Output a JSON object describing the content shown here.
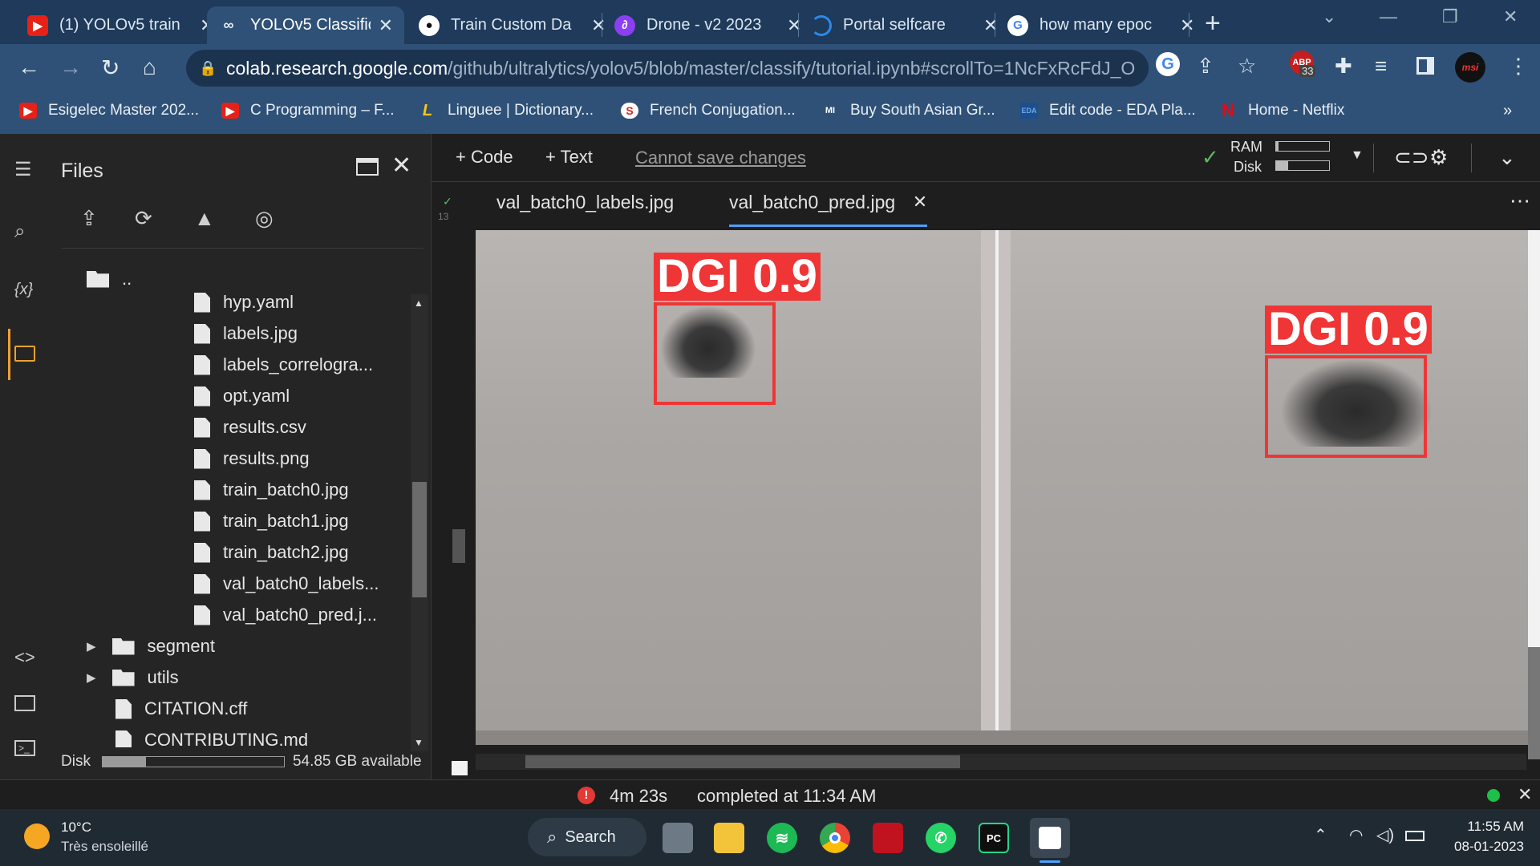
{
  "browser": {
    "tabs": [
      {
        "title": "(1) YOLOv5 train",
        "icon": "youtube-icon"
      },
      {
        "title": "YOLOv5 Classific",
        "icon": "colab-icon",
        "active": true
      },
      {
        "title": "Train Custom Da",
        "icon": "github-icon"
      },
      {
        "title": "Drone - v2 2023",
        "icon": "roboflow-icon"
      },
      {
        "title": "Portal selfcare",
        "icon": "portal-icon"
      },
      {
        "title": "how many epoc",
        "icon": "google-icon"
      }
    ],
    "url_domain": "colab.research.google.com",
    "url_path": "/github/ultralytics/yolov5/blob/master/classify/tutorial.ipynb#scrollTo=1NcFxRcFdJ_O",
    "extension_badge": "33",
    "bookmarks": [
      "Esigelec Master 202...",
      "C Programming – F...",
      "Linguee | Dictionary...",
      "French Conjugation...",
      "Buy South Asian Gr...",
      "Edit code - EDA Pla...",
      "Home - Netflix"
    ],
    "more_bookmarks": "»"
  },
  "colab": {
    "toolbar": {
      "code_label": "+ Code",
      "text_label": "+ Text",
      "cannot_save": "Cannot save changes",
      "ram_label": "RAM",
      "disk_label": "Disk",
      "ram_usage": 0.05,
      "disk_usage": 0.22
    },
    "files": {
      "title": "Files",
      "parent": "..",
      "items": [
        {
          "name": "hyp.yaml",
          "type": "file"
        },
        {
          "name": "labels.jpg",
          "type": "file"
        },
        {
          "name": "labels_correlogra...",
          "type": "file"
        },
        {
          "name": "opt.yaml",
          "type": "file"
        },
        {
          "name": "results.csv",
          "type": "file"
        },
        {
          "name": "results.png",
          "type": "file"
        },
        {
          "name": "train_batch0.jpg",
          "type": "file"
        },
        {
          "name": "train_batch1.jpg",
          "type": "file"
        },
        {
          "name": "train_batch2.jpg",
          "type": "file"
        },
        {
          "name": "val_batch0_labels...",
          "type": "file"
        },
        {
          "name": "val_batch0_pred.j...",
          "type": "file"
        },
        {
          "name": "segment",
          "type": "folder"
        },
        {
          "name": "utils",
          "type": "folder"
        },
        {
          "name": "CITATION.cff",
          "type": "file"
        },
        {
          "name": "CONTRIBUTING.md",
          "type": "file"
        }
      ],
      "disk_label": "Disk",
      "disk_available": "54.85 GB available",
      "disk_usage": 0.24
    },
    "gutter_label": "13",
    "image_tabs": [
      "val_batch0_labels.jpg",
      "val_batch0_pred.jpg"
    ],
    "detections": [
      {
        "label": "DGI 0.9"
      },
      {
        "label": "DGI 0.9"
      }
    ],
    "status": {
      "duration": "4m 23s",
      "completed": "completed at 11:34 AM"
    }
  },
  "taskbar": {
    "weather_temp": "10°C",
    "weather_desc": "Très ensoleillé",
    "search_label": "Search",
    "time": "11:55 AM",
    "date": "08-01-2023"
  },
  "colors": {
    "bbox": "#ef3535",
    "accent": "#4d9ef6",
    "chrome": "#2f5177"
  }
}
